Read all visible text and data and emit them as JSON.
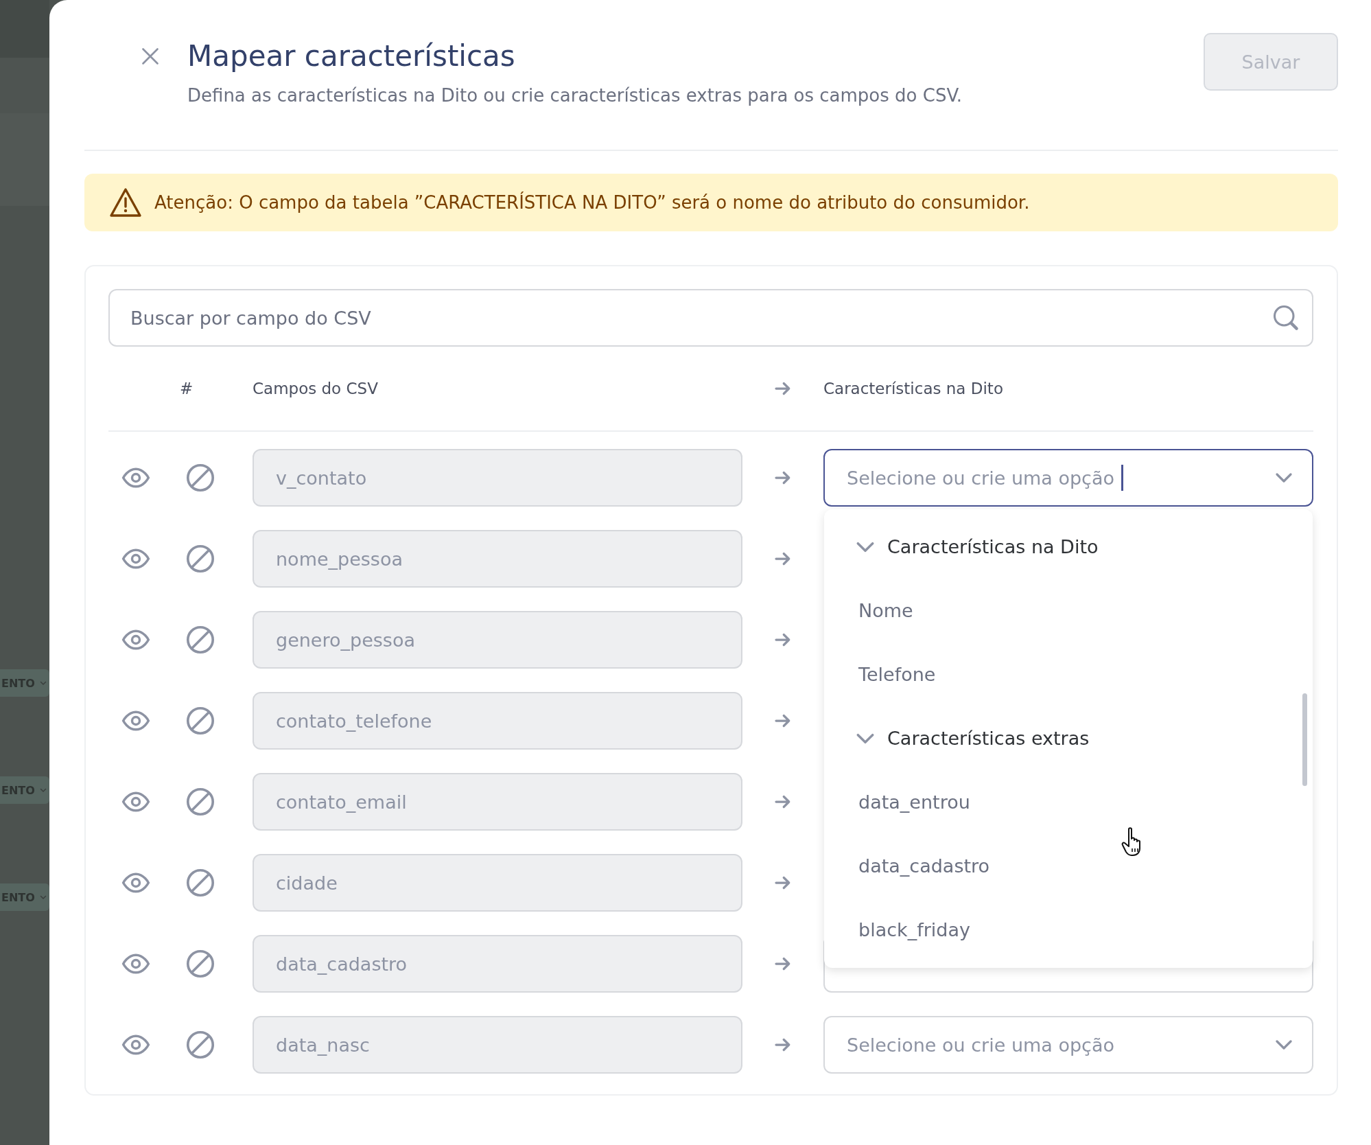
{
  "backdrop": {
    "tags": [
      {
        "label": "ENTO"
      },
      {
        "label": "ENTO"
      },
      {
        "label": "ENTO"
      }
    ]
  },
  "dialog": {
    "title": "Mapear características",
    "subtitle": "Defina as características na Dito ou crie características extras para os campos do CSV.",
    "save_button": {
      "label": "Salvar",
      "disabled": true
    }
  },
  "warning": {
    "text": "Atenção: O campo da tabela ”CARACTERÍSTICA NA DITO” será o nome do atributo do consumidor."
  },
  "search": {
    "placeholder": "Buscar por campo do CSV"
  },
  "table": {
    "columns": [
      "#",
      "Campos do CSV",
      "Características na Dito"
    ],
    "rows": [
      {
        "field": "v_contato",
        "target": {
          "placeholder": "Selecione ou crie uma opção",
          "focused": true
        }
      },
      {
        "field": "nome_pessoa"
      },
      {
        "field": "genero_pessoa"
      },
      {
        "field": "contato_telefone"
      },
      {
        "field": "contato_email"
      },
      {
        "field": "cidade"
      },
      {
        "field": "data_cadastro",
        "target": {
          "focused": false
        }
      },
      {
        "field": "data_nasc",
        "target": {
          "placeholder": "Selecione ou crie uma opção",
          "focused": false
        }
      }
    ]
  },
  "dropdown": {
    "groups": [
      {
        "label": "Características na Dito",
        "expanded": true,
        "items": [
          "Nome",
          "Telefone"
        ]
      },
      {
        "label": "Características extras",
        "expanded": true,
        "items": [
          "data_entrou",
          "data_cadastro",
          "black_friday"
        ]
      }
    ]
  }
}
